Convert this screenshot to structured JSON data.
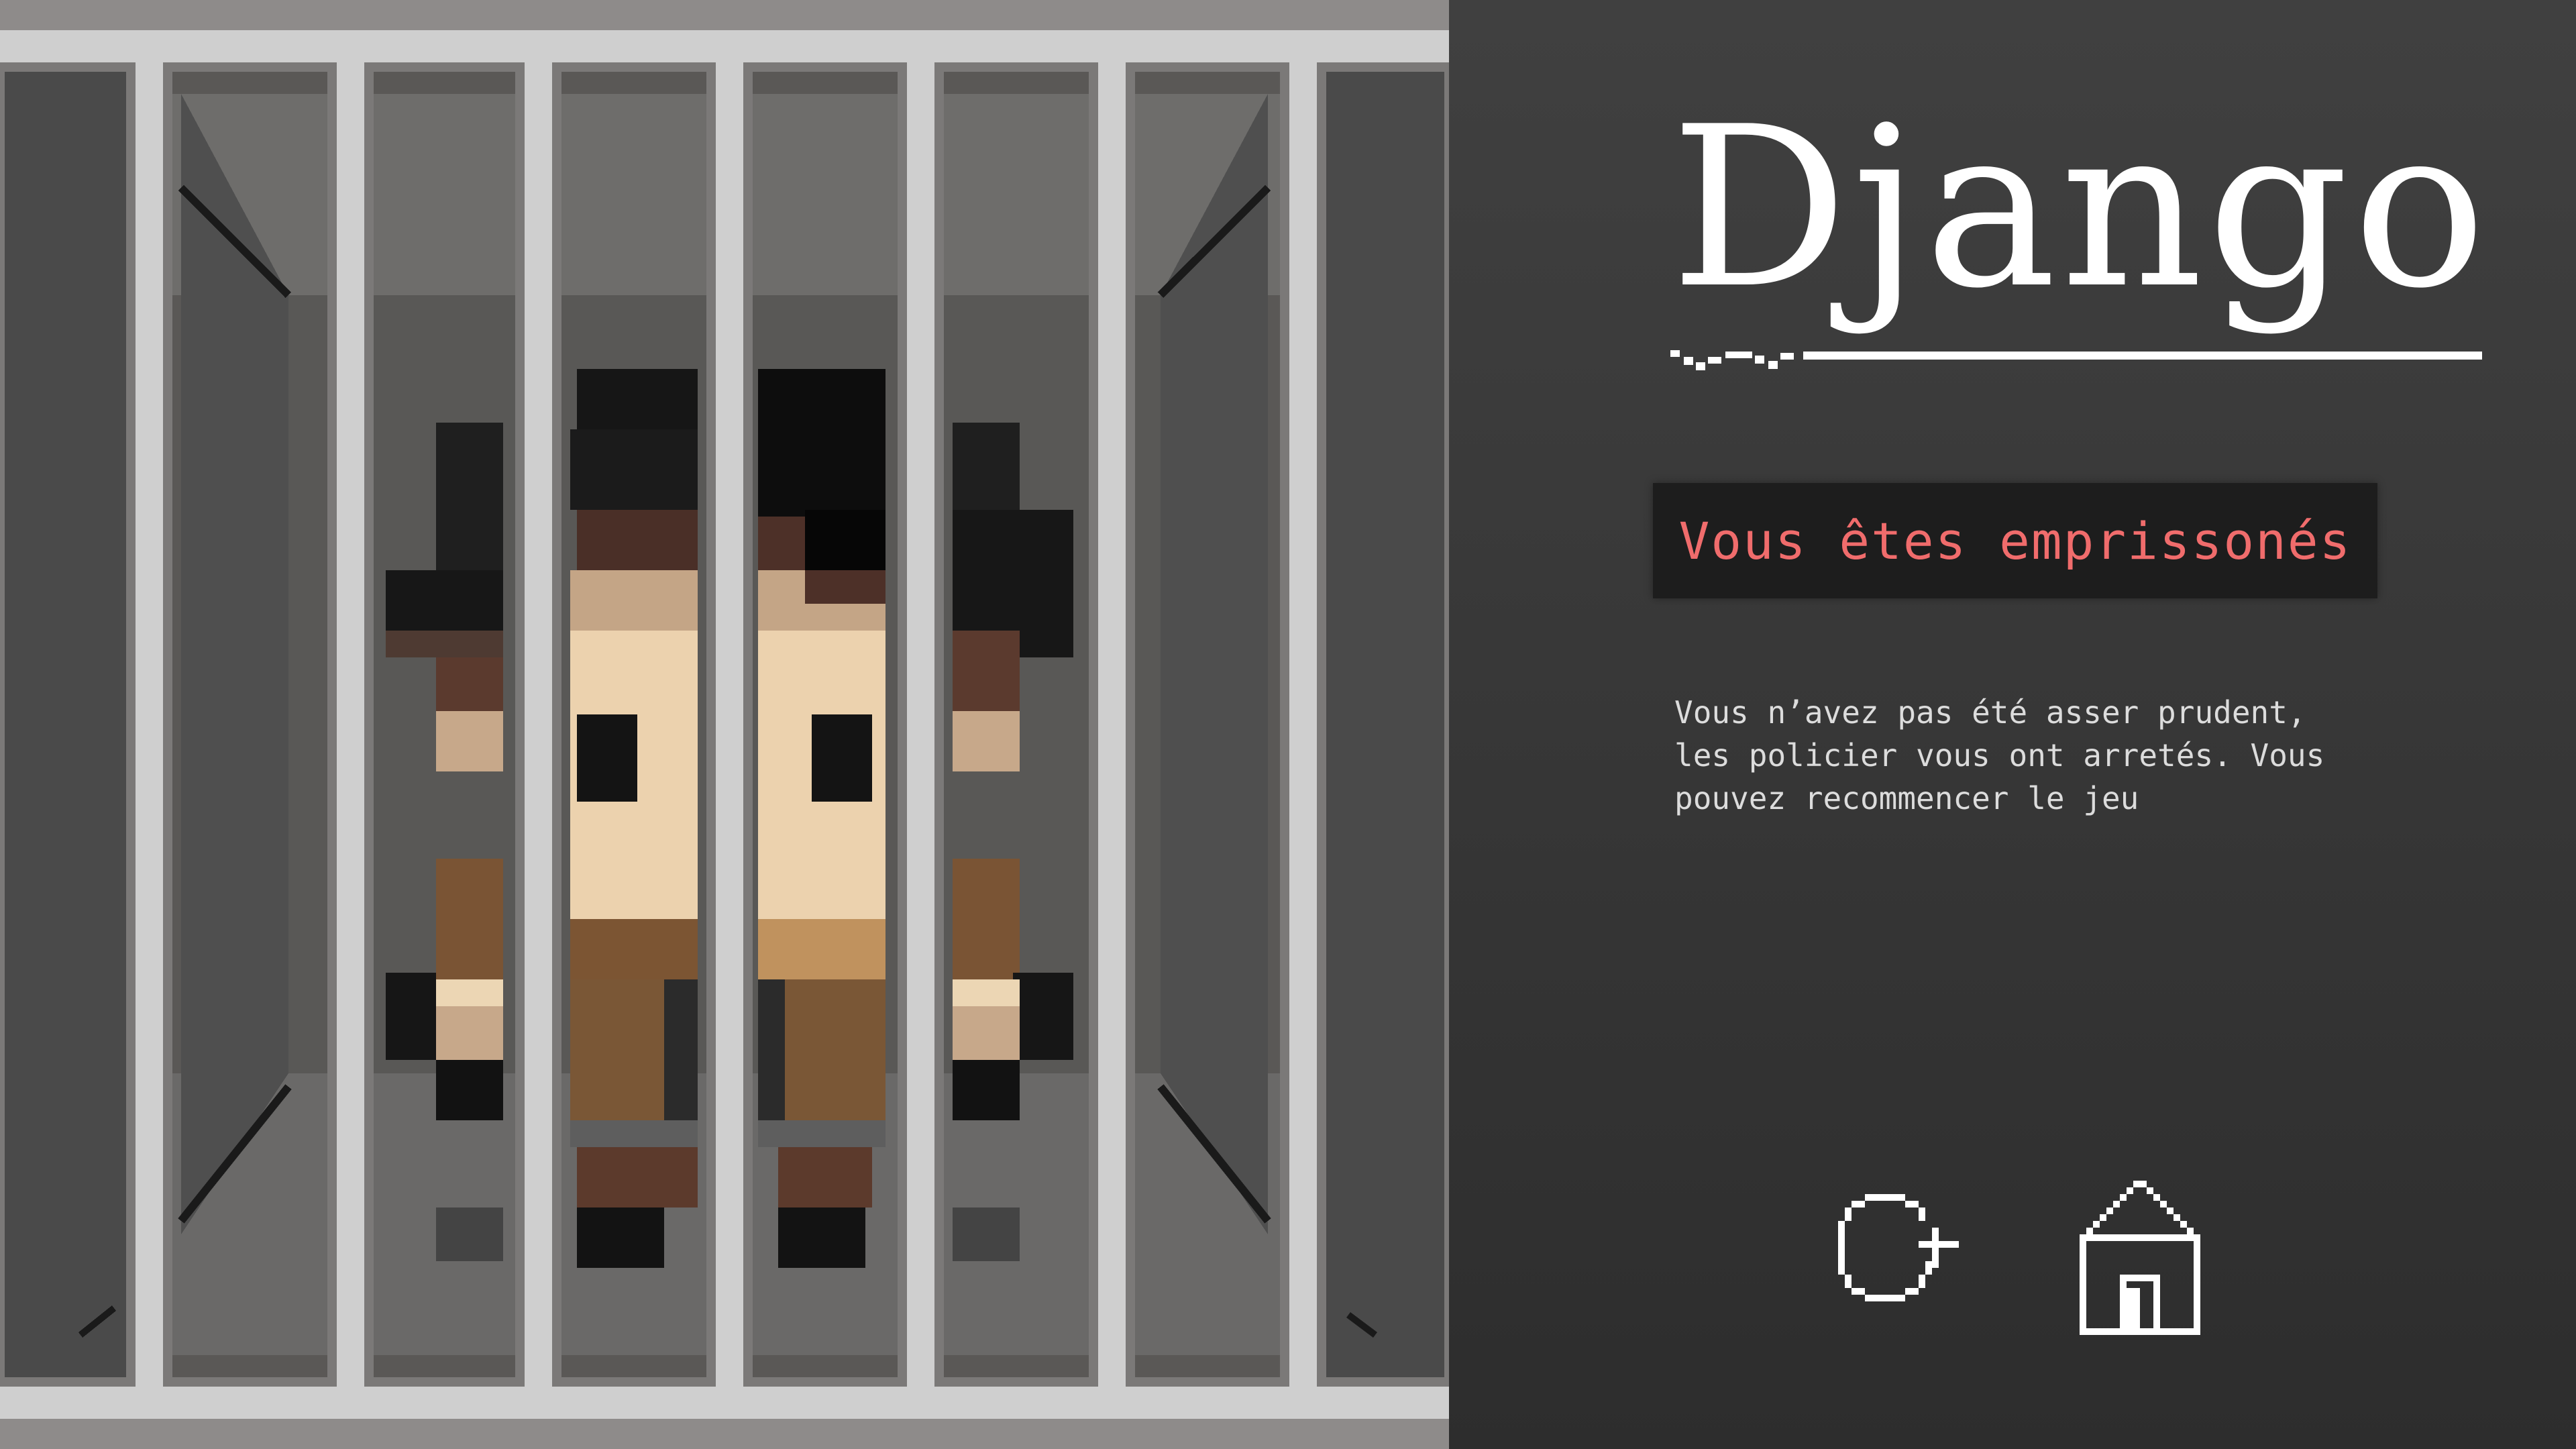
{
  "game": {
    "title": "Django",
    "status_banner": "Vous êtes emprissonés",
    "message": "Vous n’avez pas été asser prudent,\nles policier vous ont arretés. Vous\npouvez recommencer le jeu"
  },
  "scene": {
    "description_icon": "jail-scene",
    "characters": [
      "prisoner-left",
      "prisoner-right"
    ]
  },
  "controls": {
    "restart_icon": "restart-icon",
    "home_icon": "home-icon"
  },
  "colors": {
    "panel_bg": "#383838",
    "banner_bg": "#1d1d1d",
    "banner_text": "#f06c6c",
    "title": "#ffffff",
    "body_text": "#dcdcdc",
    "bars": "#cfcfcf"
  }
}
